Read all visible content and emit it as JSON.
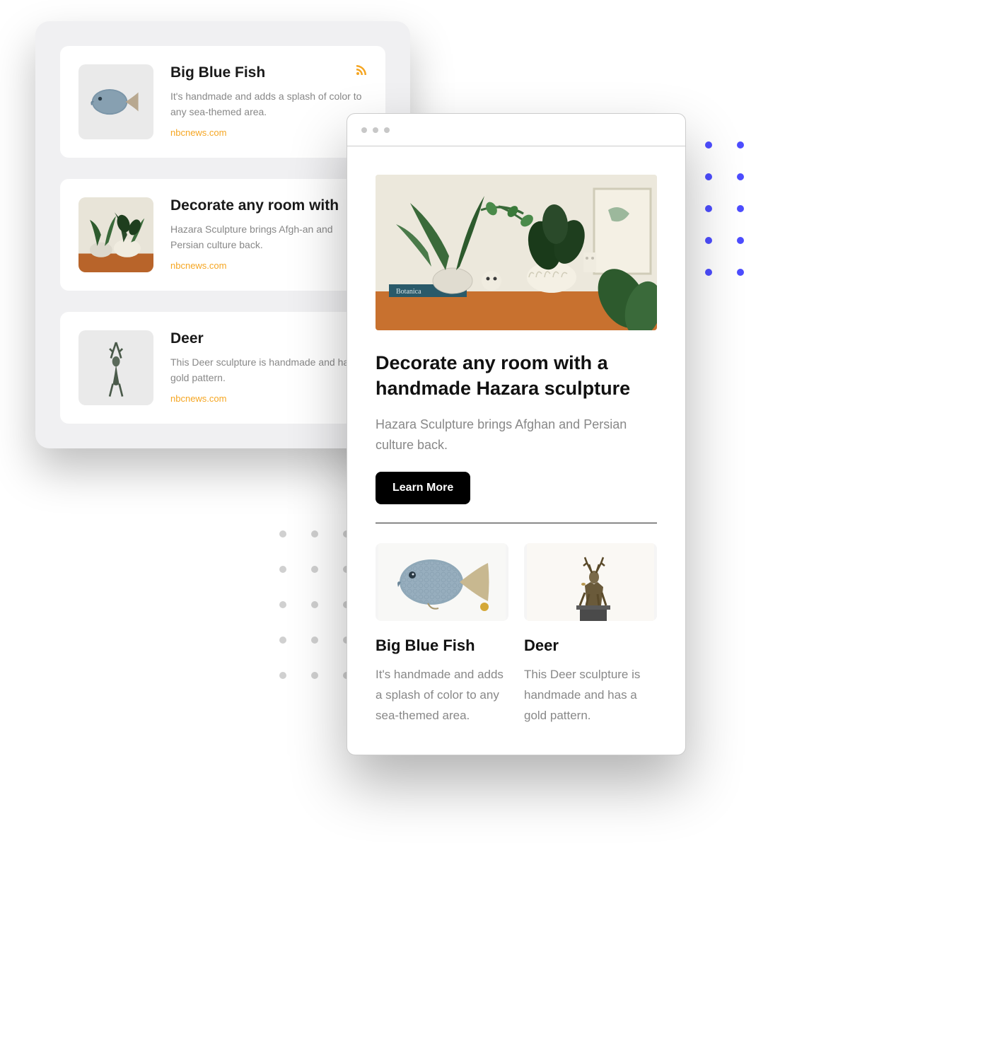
{
  "feed": {
    "items": [
      {
        "title": "Big Blue Fish",
        "desc": "It's handmade and adds a splash of color to any sea-themed area.",
        "source": "nbcnews.com",
        "has_rss": true,
        "image": "fish"
      },
      {
        "title": "Decorate any room with",
        "desc": "Hazara Sculpture brings Afgh-an and Persian culture back.",
        "source": "nbcnews.com",
        "has_rss": false,
        "image": "plants"
      },
      {
        "title": "Deer",
        "desc": "This Deer sculpture is handmade and has a gold pattern.",
        "source": "nbcnews.com",
        "has_rss": false,
        "image": "deer"
      }
    ]
  },
  "newsletter": {
    "hero": {
      "title": "Decorate any room with a handmade Hazara sculpture",
      "desc": "Hazara Sculpture brings Afghan and Persian culture back.",
      "cta_label": "Learn More",
      "image": "plants"
    },
    "products": [
      {
        "title": "Big Blue Fish",
        "desc": "It's handmade and adds a splash of color to any sea-themed area.",
        "image": "fish"
      },
      {
        "title": "Deer",
        "desc": "This Deer sculpture is handmade and has a gold pattern.",
        "image": "deer"
      }
    ]
  },
  "colors": {
    "accent_orange": "#f5a623",
    "accent_blue": "#4d4dff",
    "cta_bg": "#000000"
  }
}
